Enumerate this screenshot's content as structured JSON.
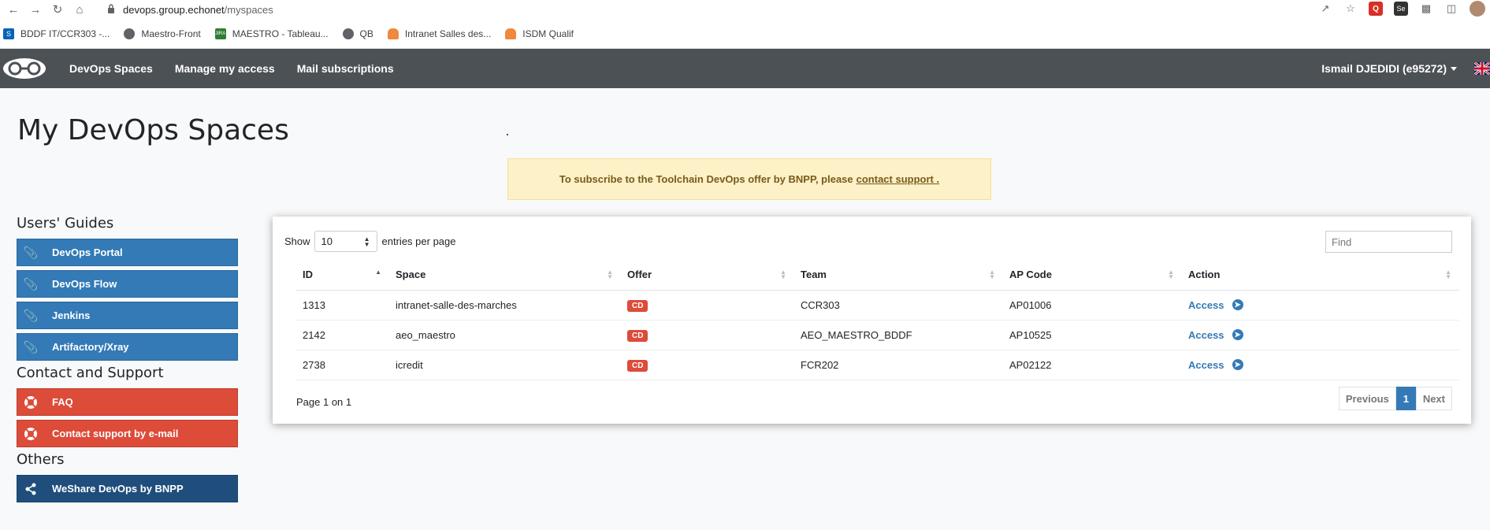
{
  "browser": {
    "url_host": "devops.group.echonet",
    "url_path": "/myspaces"
  },
  "bookmarks": [
    {
      "label": "BDDF IT/CCR303 -...",
      "icon": "sharepoint-icon",
      "color": "#0364b8"
    },
    {
      "label": "Maestro-Front",
      "icon": "globe-icon",
      "color": "#5f6368"
    },
    {
      "label": "MAESTRO - Tableau...",
      "icon": "jira-icon",
      "color": "#2e7d32"
    },
    {
      "label": "QB",
      "icon": "globe-icon",
      "color": "#5f6368"
    },
    {
      "label": "Intranet Salles des...",
      "icon": "cloud-icon",
      "color": "#f0883e"
    },
    {
      "label": "ISDM Qualif",
      "icon": "cloud-icon",
      "color": "#f0883e"
    }
  ],
  "navbar": {
    "links": [
      "DevOps Spaces",
      "Manage my access",
      "Mail subscriptions"
    ],
    "user": "Ismail DJEDIDI (e95272)"
  },
  "page": {
    "title": "My DevOps Spaces",
    "alert_text": "To subscribe to the Toolchain DevOps offer by BNPP, please",
    "alert_link": "contact support ."
  },
  "sidebar": {
    "guides_heading": "Users' Guides",
    "guides": [
      "DevOps Portal",
      "DevOps Flow",
      "Jenkins",
      "Artifactory/Xray"
    ],
    "contact_heading": "Contact and Support",
    "contact": [
      "FAQ",
      "Contact support by e-mail"
    ],
    "others_heading": "Others",
    "others": [
      "WeShare DevOps by BNPP"
    ]
  },
  "table": {
    "show_label": "Show",
    "entries_value": "10",
    "entries_label": "entries per page",
    "find_placeholder": "Find",
    "columns": [
      "ID",
      "Space",
      "Offer",
      "Team",
      "AP Code",
      "Action"
    ],
    "rows": [
      {
        "id": "1313",
        "space": "intranet-salle-des-marches",
        "offer": "CD",
        "team": "CCR303",
        "ap_code": "AP01006",
        "action": "Access"
      },
      {
        "id": "2142",
        "space": "aeo_maestro",
        "offer": "CD",
        "team": "AEO_MAESTRO_BDDF",
        "ap_code": "AP10525",
        "action": "Access"
      },
      {
        "id": "2738",
        "space": "icredit",
        "offer": "CD",
        "team": "FCR202",
        "ap_code": "AP02122",
        "action": "Access"
      }
    ],
    "page_info": "Page 1 on 1",
    "pager": {
      "previous": "Previous",
      "current": "1",
      "next": "Next"
    }
  },
  "colors": {
    "navbar": "#4c5156",
    "primary": "#337ab7",
    "danger": "#dd4b39",
    "dark_blue": "#1f4e7c",
    "alert_bg": "#fcf1c7"
  }
}
